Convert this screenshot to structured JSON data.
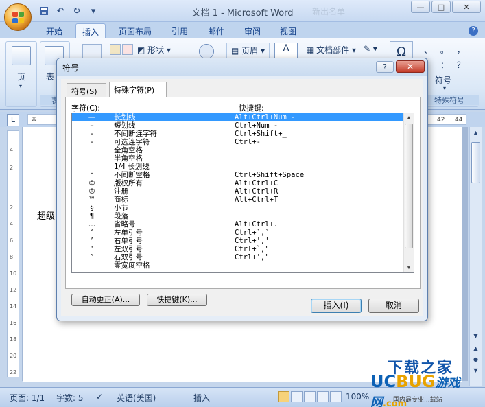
{
  "window": {
    "title": "文档 1 - Microsoft Word",
    "faded_title": "新出名单",
    "min": "—",
    "max": "□",
    "close": "✕"
  },
  "qat": [
    "save-icon",
    "undo-icon",
    "redo-icon",
    "customize-icon"
  ],
  "ribbon_tabs": [
    "开始",
    "插入",
    "页面布局",
    "引用",
    "邮件",
    "审阅",
    "视图"
  ],
  "active_tab": "插入",
  "help": "?",
  "ribbon": {
    "page_label": "页",
    "table_label": "表",
    "table_group_label": "表",
    "shapes": "形状",
    "header": "页眉",
    "doc_parts": "文档部件",
    "symbol": "符号",
    "special_symbol_group": "特殊符号",
    "punct_row1": "、 。 ，",
    "punct_row2": "； ： ？",
    "omega": "Ω"
  },
  "ruler": {
    "tab_btn": "L",
    "numbers": [
      "42",
      "44"
    ],
    "vertical": [
      "4",
      "2",
      "2",
      "4",
      "6",
      "8",
      "10",
      "12",
      "14",
      "16",
      "18",
      "20",
      "22"
    ]
  },
  "document": {
    "text": "超级"
  },
  "statusbar": {
    "page": "页面: 1/1",
    "words": "字数: 5",
    "language": "英语(美国)",
    "mode": "插入",
    "zoom": "100%"
  },
  "watermark": {
    "line1": "下载之家",
    "uc": "UC",
    "bug": "BUG",
    "game": "游戏网",
    "com": ".com",
    "line3": "国内最专业...载站"
  },
  "dialog": {
    "title": "符号",
    "help": "?",
    "close": "✕",
    "tabs": [
      "符号(S)",
      "特殊字符(P)"
    ],
    "active_tab": "特殊字符(P)",
    "col_char": "字符(C):",
    "col_shortcut": "快捷键:",
    "rows": [
      {
        "sym": "—",
        "name": "长划线",
        "shortcut": "Alt+Ctrl+Num -"
      },
      {
        "sym": "–",
        "name": "短划线",
        "shortcut": "Ctrl+Num -"
      },
      {
        "sym": "-",
        "name": "不间断连字符",
        "shortcut": "Ctrl+Shift+_"
      },
      {
        "sym": "-",
        "name": "可选连字符",
        "shortcut": "Ctrl+-"
      },
      {
        "sym": "",
        "name": "全角空格",
        "shortcut": ""
      },
      {
        "sym": "",
        "name": "半角空格",
        "shortcut": ""
      },
      {
        "sym": "",
        "name": "1/4 长划线",
        "shortcut": ""
      },
      {
        "sym": "°",
        "name": "不间断空格",
        "shortcut": "Ctrl+Shift+Space"
      },
      {
        "sym": "©",
        "name": "版权所有",
        "shortcut": "Alt+Ctrl+C"
      },
      {
        "sym": "®",
        "name": "注册",
        "shortcut": "Alt+Ctrl+R"
      },
      {
        "sym": "™",
        "name": "商标",
        "shortcut": "Alt+Ctrl+T"
      },
      {
        "sym": "§",
        "name": "小节",
        "shortcut": ""
      },
      {
        "sym": "¶",
        "name": "段落",
        "shortcut": ""
      },
      {
        "sym": "…",
        "name": "省略号",
        "shortcut": "Alt+Ctrl+."
      },
      {
        "sym": "‘",
        "name": "左单引号",
        "shortcut": "Ctrl+`,`"
      },
      {
        "sym": "’",
        "name": "右单引号",
        "shortcut": "Ctrl+',' "
      },
      {
        "sym": "“",
        "name": "左双引号",
        "shortcut": "Ctrl+`,\""
      },
      {
        "sym": "”",
        "name": "右双引号",
        "shortcut": "Ctrl+',\""
      },
      {
        "sym": "",
        "name": "零宽度空格",
        "shortcut": ""
      }
    ],
    "selected_index": 0,
    "autocorrect": "自动更正(A)...",
    "shortcut_key": "快捷键(K)...",
    "insert": "插入(I)",
    "cancel": "取消"
  }
}
